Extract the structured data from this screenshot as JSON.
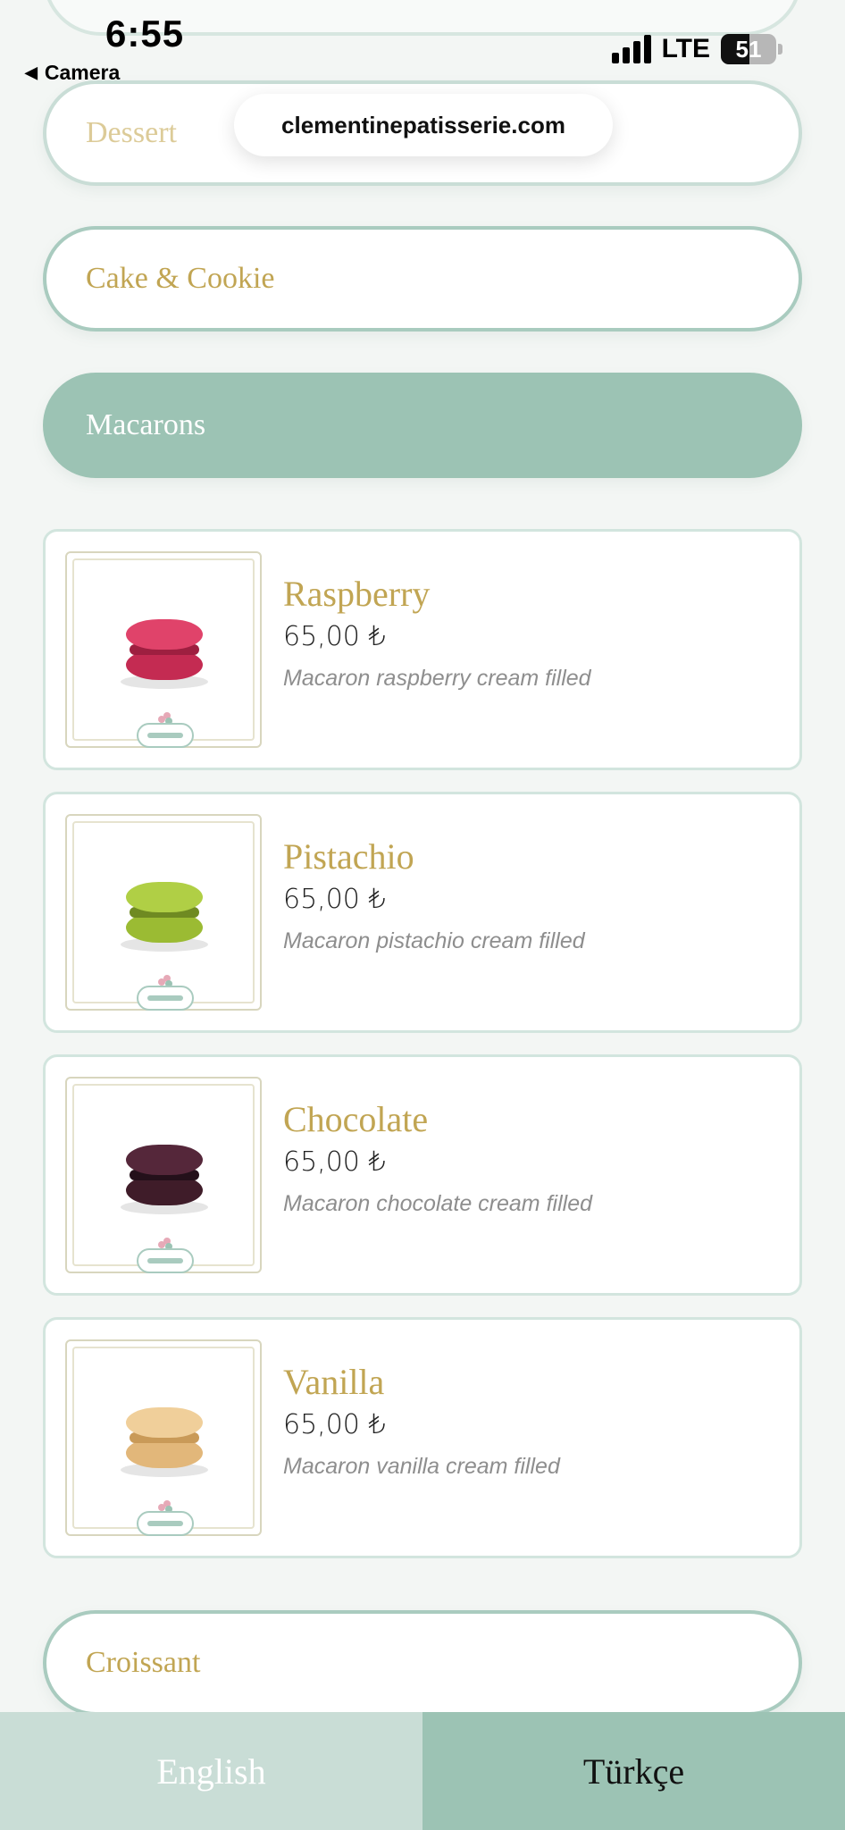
{
  "status_bar": {
    "time": "6:55",
    "back_label": "Camera",
    "network": "LTE",
    "battery": "51"
  },
  "browser": {
    "url": "clementinepatisserie.com"
  },
  "categories": [
    {
      "label": "Dessert"
    },
    {
      "label": "Cake & Cookie"
    },
    {
      "label": "Macarons"
    },
    {
      "label": "Croissant"
    }
  ],
  "products": [
    {
      "name": "Raspberry",
      "price": "65,00 ₺",
      "description": "Macaron raspberry cream filled",
      "color": "#d9375f"
    },
    {
      "name": "Pistachio",
      "price": "65,00 ₺",
      "description": "Macaron pistachio cream filled",
      "color": "#a7c73d"
    },
    {
      "name": "Chocolate",
      "price": "65,00 ₺",
      "description": "Macaron chocolate cream filled",
      "color": "#4b2231"
    },
    {
      "name": "Vanilla",
      "price": "65,00 ₺",
      "description": "Macaron vanilla cream filled",
      "color": "#e9c690"
    }
  ],
  "language": {
    "english": "English",
    "turkish": "Türkçe"
  },
  "colors": {
    "accent_green": "#9cc3b4",
    "gold_text": "#c1a553"
  }
}
